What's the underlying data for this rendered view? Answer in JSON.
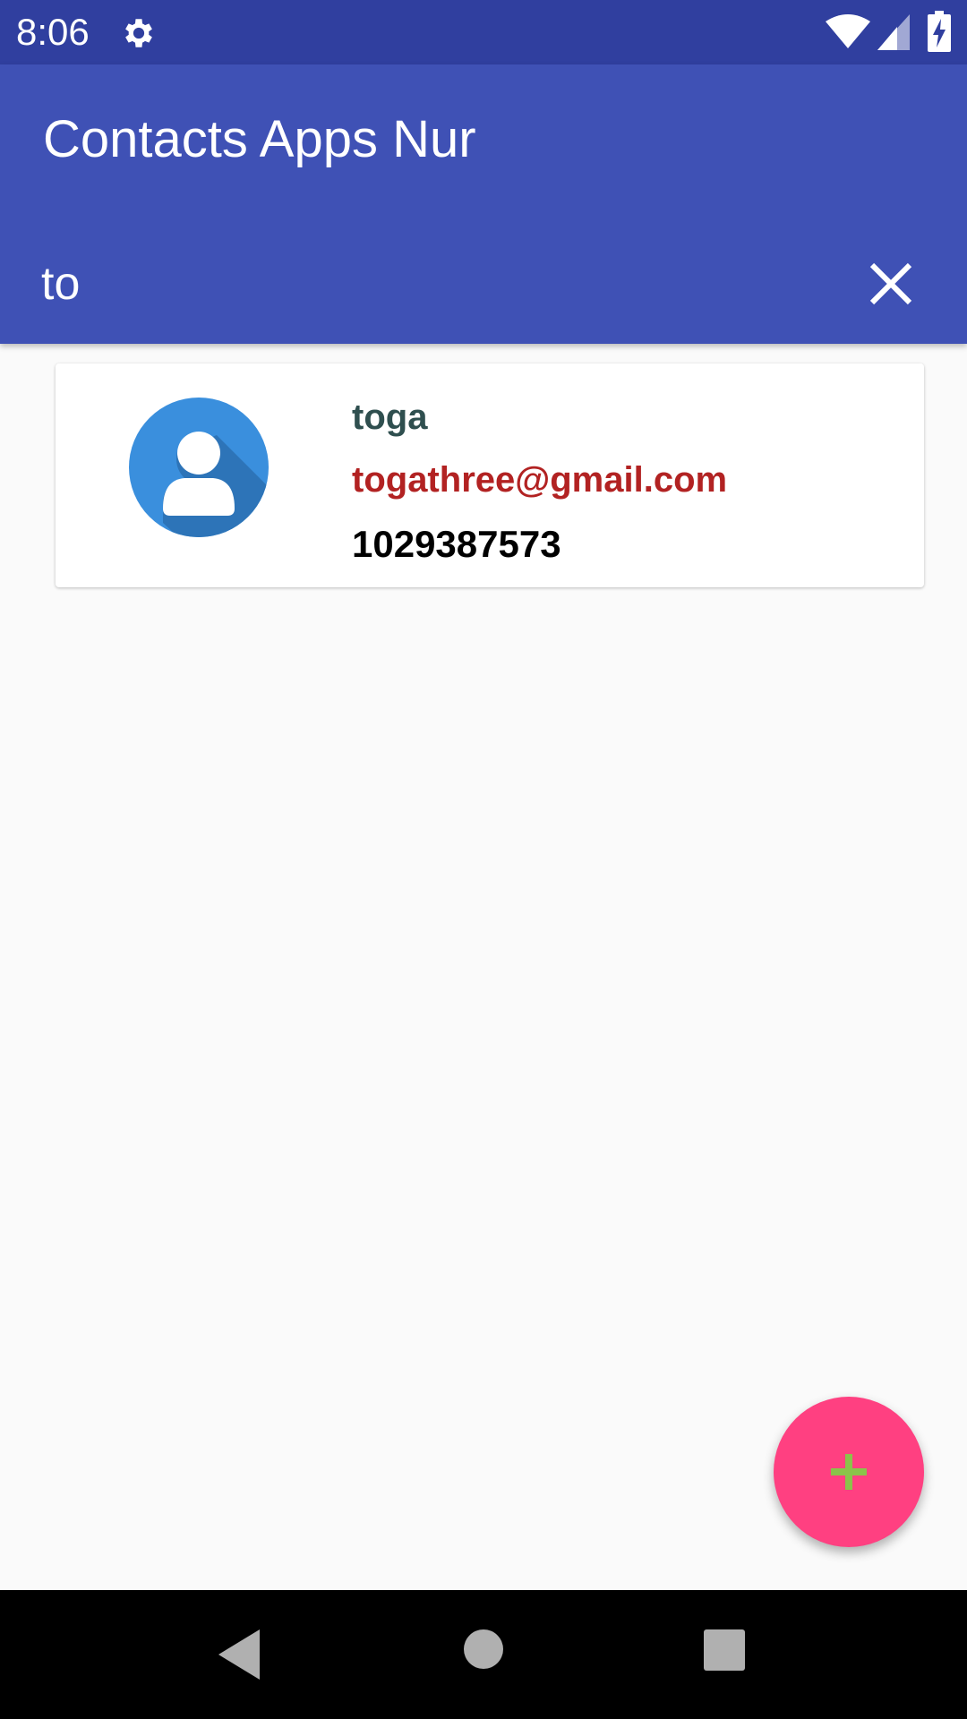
{
  "status_bar": {
    "time": "8:06",
    "icons": [
      "settings-gear-icon",
      "wifi-icon",
      "cell-signal-icon",
      "battery-charging-icon"
    ]
  },
  "app_bar": {
    "title": "Contacts Apps Nur",
    "search_value": "to",
    "clear_icon": "close-icon"
  },
  "contacts": [
    {
      "name": "toga",
      "email": "togathree@gmail.com",
      "phone": "1029387573",
      "avatar_icon": "person-avatar-icon"
    }
  ],
  "fab": {
    "icon": "plus-icon"
  },
  "nav_bar": {
    "icons": [
      "back-icon",
      "home-icon",
      "recents-icon"
    ]
  },
  "colors": {
    "status_bar": "#303f9f",
    "app_bar": "#3f51b5",
    "fab": "#ff4081",
    "fab_icon": "#8bc34a",
    "name_text": "#2f4f4f",
    "email_text": "#b22222",
    "avatar": "#3a8fdd"
  }
}
